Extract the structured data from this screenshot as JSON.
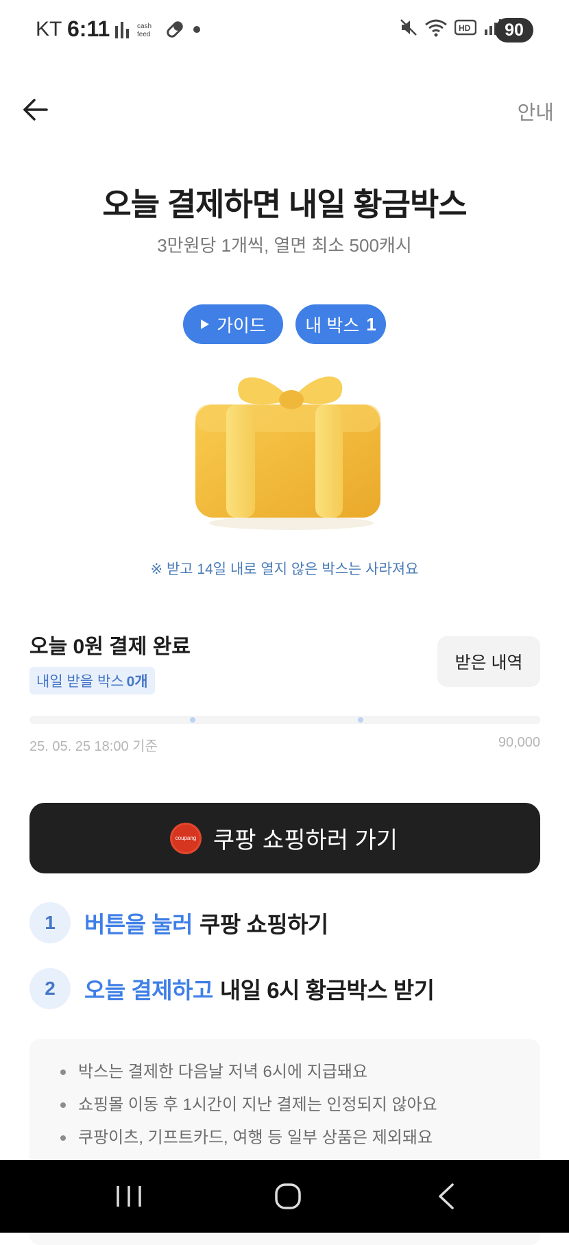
{
  "status_bar": {
    "carrier": "KT",
    "time": "6:11",
    "left_icons": [
      "signal-bars-icon",
      "cashfeed-icon",
      "pill-icon",
      "dot-icon"
    ],
    "right_icons": [
      "mute-icon",
      "wifi-icon",
      "hd-icon",
      "cell-signal-icon"
    ],
    "battery": "90"
  },
  "header": {
    "guide_link": "안내"
  },
  "hero": {
    "title": "오늘 결제하면 내일 황금박스",
    "subtitle": "3만원당 1개씩, 열면 최소 500캐시",
    "guide_button": "가이드",
    "my_box_label": "내 박스",
    "my_box_count": "1",
    "notice": "※ 받고 14일 내로 열지 않은 박스는 사라져요"
  },
  "payment": {
    "title": "오늘 0원 결제 완료",
    "tomorrow_label": "내일 받을 박스",
    "tomorrow_count": "0개",
    "history_button": "받은 내역",
    "progress": 0,
    "date_label": "25. 05. 25 18:00 기준",
    "max_label": "90,000"
  },
  "shop_button": {
    "logo_text": "coupang",
    "label": "쿠팡 쇼핑하러 가기"
  },
  "steps": [
    {
      "num": "1",
      "highlight": "버튼을 눌러",
      "text": "쿠팡 쇼핑하기"
    },
    {
      "num": "2",
      "highlight": "오늘 결제하고",
      "text": "내일 6시 황금박스 받기"
    }
  ],
  "info": [
    "박스는 결제한 다음날 저녁 6시에 지급돼요",
    "쇼핑몰 이동 후 1시간이 지난 결제는 인정되지 않아요",
    "쿠팡이츠, 기프트카드, 여행 등 일부 상품은 제외돼요"
  ],
  "colors": {
    "accent": "#3f7fe6",
    "dark_button": "#202020",
    "badge_bg": "#e8f0fc",
    "notice_text": "#4a7bb7",
    "gift": "#f5bd3a"
  }
}
